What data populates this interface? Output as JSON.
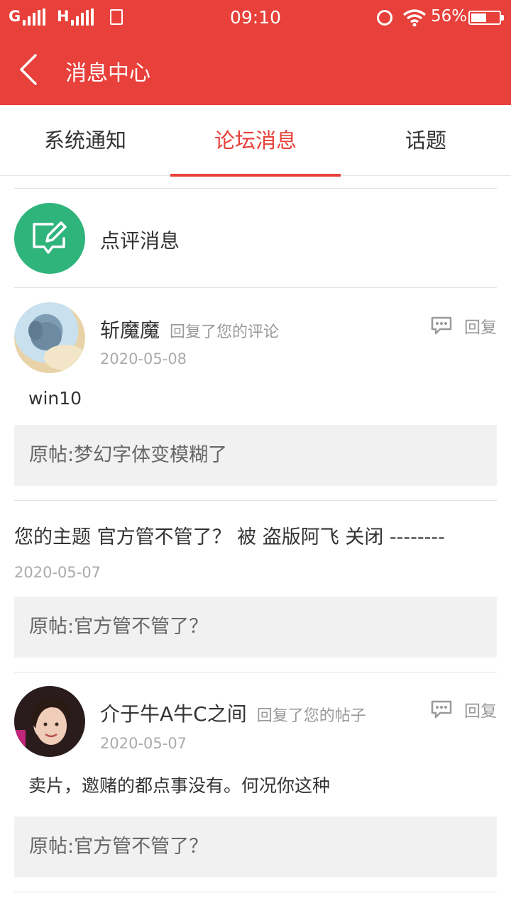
{
  "status_bar": {
    "carrier_left": "G",
    "carrier_right": "H",
    "time": "09:10",
    "battery_percent": "56%",
    "battery_level": 0.56
  },
  "header": {
    "title": "消息中心",
    "back_icon": "chevron-left-icon"
  },
  "tabs": [
    {
      "label": "系统通知",
      "active": false
    },
    {
      "label": "论坛消息",
      "active": true
    },
    {
      "label": "话题",
      "active": false
    }
  ],
  "review": {
    "label": "点评消息",
    "icon": "edit-comment-icon"
  },
  "messages": [
    {
      "username": "斩魔魔",
      "action": "回复了您的评论",
      "date": "2020-05-08",
      "reply_label": "回复",
      "content": "win10",
      "original_post": "原帖:梦幻字体变模糊了"
    },
    {
      "topic_text": "您的主题 官方管不管了？ 被 盗版阿飞 关闭 --------",
      "date": "2020-05-07",
      "original_post": "原帖:官方管不管了？"
    },
    {
      "username": "介于牛A牛C之间",
      "action": "回复了您的帖子",
      "date": "2020-05-07",
      "reply_label": "回复",
      "content": "卖片，邀赌的都点事没有。何况你这种",
      "original_post": "原帖:官方管不管了？"
    }
  ],
  "colors": {
    "accent": "#e8403a",
    "review_icon_bg": "#2fb47c",
    "muted": "#999999"
  }
}
